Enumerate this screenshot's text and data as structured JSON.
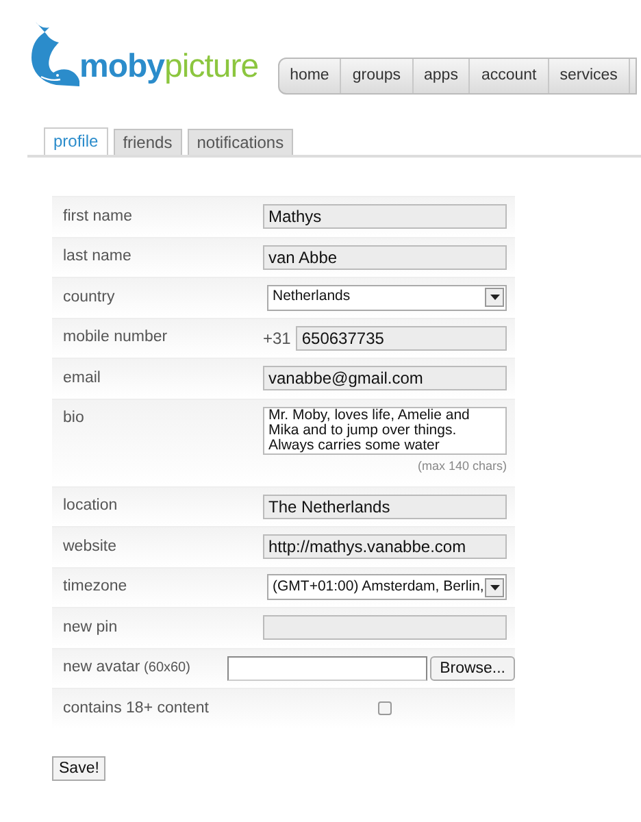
{
  "logo": {
    "part_1": "moby",
    "part_2": "picture"
  },
  "nav": [
    {
      "label": "home"
    },
    {
      "label": "groups"
    },
    {
      "label": "apps"
    },
    {
      "label": "account"
    },
    {
      "label": "services"
    }
  ],
  "tabs": [
    {
      "label": "profile",
      "selected": true
    },
    {
      "label": "friends",
      "selected": false
    },
    {
      "label": "notifications",
      "selected": false
    }
  ],
  "form": [
    {
      "kind": "text",
      "label": "first name",
      "value": "Mathys"
    },
    {
      "kind": "text",
      "label": "last name",
      "value": "van Abbe"
    },
    {
      "kind": "select",
      "label": "country",
      "value": "Netherlands"
    },
    {
      "kind": "phone",
      "label": "mobile number",
      "prefix": "+31",
      "value": "650637735"
    },
    {
      "kind": "text",
      "label": "email",
      "value": "vanabbe@gmail.com"
    },
    {
      "kind": "textarea",
      "label": "bio",
      "value": "Mr. Moby, loves life, Amelie and Mika and to jump over things. Always carries some water",
      "hint": "(max 140 chars)"
    },
    {
      "kind": "text",
      "label": "location",
      "value": "The Netherlands"
    },
    {
      "kind": "text",
      "label": "website",
      "value": "http://mathys.vanabbe.com"
    },
    {
      "kind": "select",
      "label": "timezone",
      "value": "(GMT+01:00) Amsterdam, Berlin,"
    },
    {
      "kind": "text",
      "label": "new pin"
    },
    {
      "kind": "file",
      "label": "new avatar",
      "note": "(60x60)",
      "button": "Browse..."
    },
    {
      "kind": "checkbox",
      "label": "contains 18+ content",
      "checked": false
    }
  ],
  "save_button": "Save!"
}
